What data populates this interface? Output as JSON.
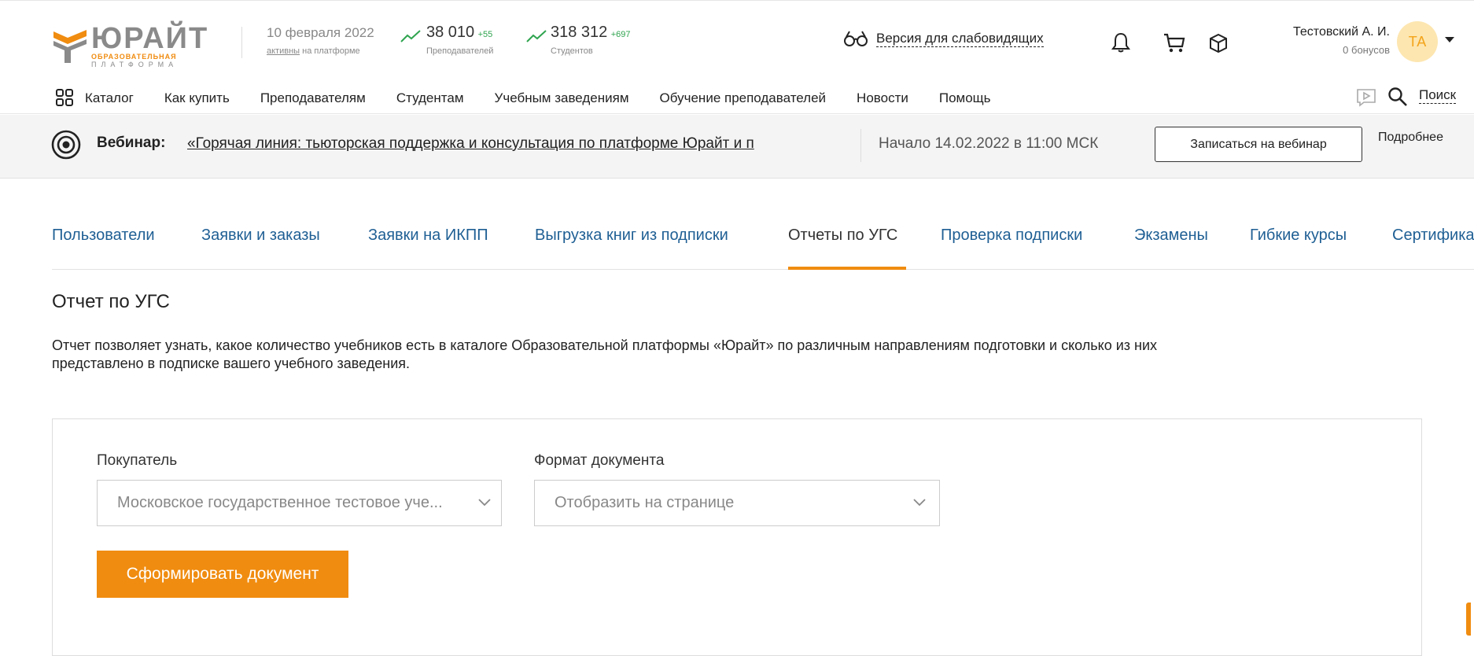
{
  "header": {
    "logo": {
      "name": "ЮРАЙТ",
      "line1": "ОБРАЗОВАТЕЛЬНАЯ",
      "line2": "ПЛАТФОРМА"
    },
    "date": "10 февраля 2022",
    "active_link": "активны",
    "active_suffix": "на платформе",
    "teachers": {
      "count": "38 010",
      "delta": "+55",
      "label": "Преподавателей"
    },
    "students": {
      "count": "318 312",
      "delta": "+697",
      "label": "Студентов"
    },
    "vision_label": "Версия для слабовидящих",
    "user": {
      "name": "Тестовский А. И.",
      "bonus": "0 бонусов",
      "initials": "ТА"
    }
  },
  "nav": {
    "items": [
      "Каталог",
      "Как купить",
      "Преподавателям",
      "Студентам",
      "Учебным заведениям",
      "Обучение преподавателей",
      "Новости",
      "Помощь"
    ],
    "search_label": "Поиск"
  },
  "webinar": {
    "label": "Вебинар:",
    "title": "«Горячая линия: тьюторская поддержка и консультация по платформе Юрайт и п",
    "start": "Начало 14.02.2022 в 11:00 МСК",
    "register_label": "Записаться на вебинар",
    "more_label": "Подробнее"
  },
  "tabs": {
    "items": [
      "Пользователи",
      "Заявки и заказы",
      "Заявки на ИКПП",
      "Выгрузка книг из подписки",
      "Отчеты по УГС",
      "Проверка подписки",
      "Экзамены",
      "Гибкие курсы",
      "Сертифика"
    ],
    "active_index": 4
  },
  "page": {
    "title": "Отчет по УГС",
    "description_line1": "Отчет позволяет узнать, какое количество учебников есть в каталоге Образовательной платформы «Юрайт» по различным направлениям подготовки и сколько из них",
    "description_line2": "представлено в подписке вашего учебного заведения."
  },
  "form": {
    "buyer_label": "Покупатель",
    "buyer_value": "Московское государственное тестовое уче...",
    "format_label": "Формат документа",
    "format_value": "Отобразить на странице",
    "submit_label": "Сформировать документ"
  },
  "colors": {
    "accent": "#f08c10",
    "link": "#1f5f94",
    "positive": "#2fa44f"
  }
}
